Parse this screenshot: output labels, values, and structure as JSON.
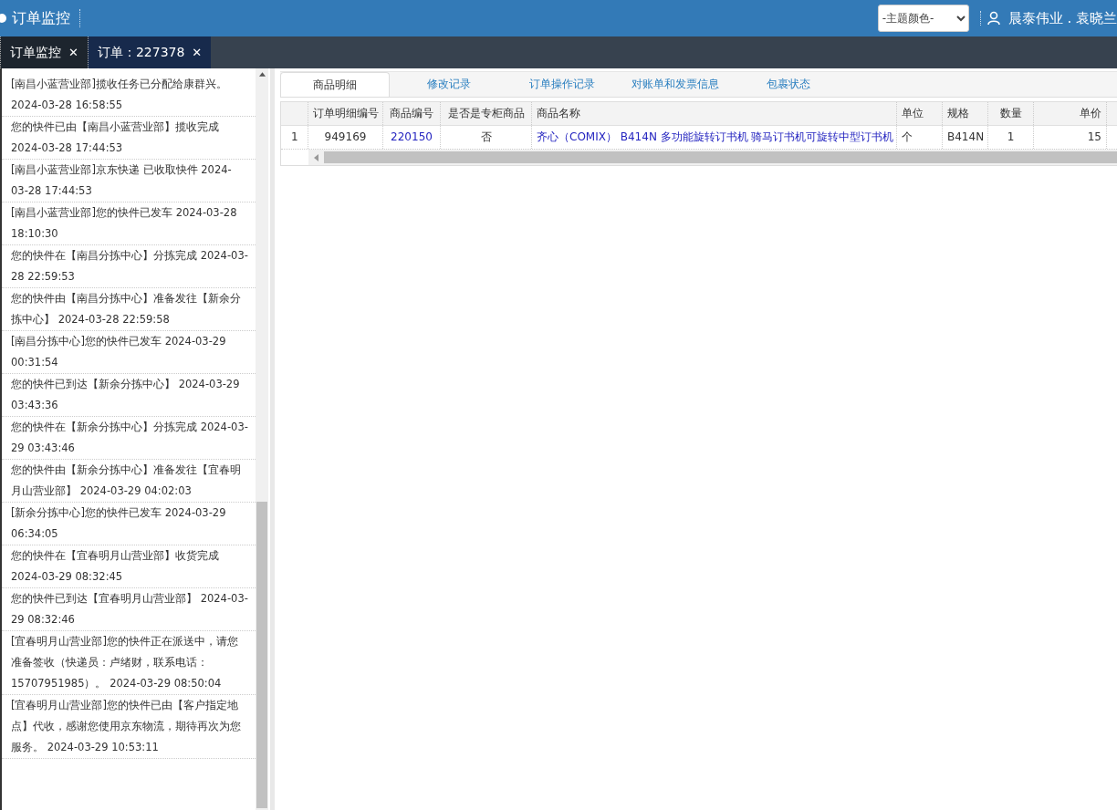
{
  "header": {
    "title": "订单监控",
    "theme_select": "-主题颜色-",
    "user": "晨泰伟业 . 袁晓兰"
  },
  "tabs": [
    {
      "label": "订单监控",
      "close": "✕",
      "selected": false
    },
    {
      "label": "订单：227378",
      "close": "✕",
      "selected": true
    }
  ],
  "log": [
    {
      "text": "[南昌小蓝营业部]揽收任务已分配给康群兴。 2024-03-28 16:58:55"
    },
    {
      "text": "您的快件已由【南昌小蓝营业部】揽收完成 2024-03-28 17:44:53"
    },
    {
      "text": "[南昌小蓝营业部]京东快递 已收取快件 2024-03-28 17:44:53"
    },
    {
      "text": "[南昌小蓝营业部]您的快件已发车 2024-03-28 18:10:30"
    },
    {
      "text": "您的快件在【南昌分拣中心】分拣完成 2024-03-28 22:59:53"
    },
    {
      "text": "您的快件由【南昌分拣中心】准备发往【新余分拣中心】 2024-03-28 22:59:58"
    },
    {
      "text": "[南昌分拣中心]您的快件已发车 2024-03-29 00:31:54"
    },
    {
      "text": "您的快件已到达【新余分拣中心】 2024-03-29 03:43:36"
    },
    {
      "text": "您的快件在【新余分拣中心】分拣完成 2024-03-29 03:43:46"
    },
    {
      "text": "您的快件由【新余分拣中心】准备发往【宜春明月山营业部】 2024-03-29 04:02:03"
    },
    {
      "text": "[新余分拣中心]您的快件已发车 2024-03-29 06:34:05"
    },
    {
      "text": "您的快件在【宜春明月山营业部】收货完成 2024-03-29 08:32:45"
    },
    {
      "text": "您的快件已到达【宜春明月山营业部】 2024-03-29 08:32:46"
    },
    {
      "text": "[宜春明月山营业部]您的快件正在派送中，请您准备签收（快递员：卢绪财，联系电话：15707951985）。 2024-03-29 08:50:04"
    },
    {
      "text": "[宜春明月山营业部]您的快件已由【客户指定地点】代收，感谢您使用京东物流，期待再次为您服务。 2024-03-29 10:53:11"
    }
  ],
  "subtabs": [
    {
      "label": "商品明细",
      "selected": true
    },
    {
      "label": "修改记录",
      "selected": false
    },
    {
      "label": "订单操作记录",
      "selected": false
    },
    {
      "label": "对账单和发票信息",
      "selected": false
    },
    {
      "label": "包裹状态",
      "selected": false
    }
  ],
  "table": {
    "columns": [
      "订单明细编号",
      "商品编号",
      "是否是专柜商品",
      "商品名称",
      "单位",
      "规格",
      "数量",
      "单价"
    ],
    "rows": [
      {
        "index": "1",
        "cells": [
          {
            "text": "949169",
            "link": false
          },
          {
            "text": "220150",
            "link": true
          },
          {
            "text": "否",
            "link": false
          },
          {
            "text": "齐心（COMIX） B414N 多功能旋转订书机 骑马订书机可旋转中型订书机",
            "link": true
          },
          {
            "text": "个",
            "link": false
          },
          {
            "text": "B414N",
            "link": false
          },
          {
            "text": "1",
            "link": false
          },
          {
            "text": "15",
            "link": false
          }
        ]
      }
    ]
  }
}
